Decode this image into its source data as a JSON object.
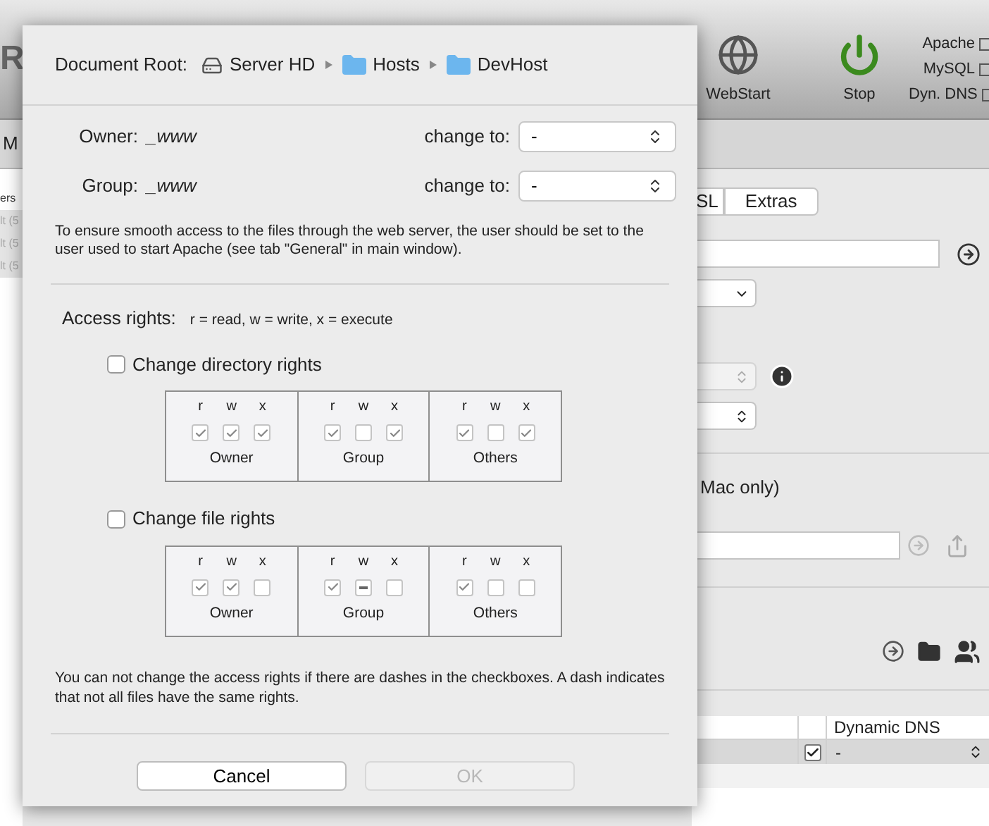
{
  "toolbar": {
    "logo": "R",
    "buttons": [
      {
        "label": "WebStart",
        "kind": "globe"
      },
      {
        "label": "Stop",
        "kind": "power"
      }
    ],
    "status": [
      {
        "label": "Apache"
      },
      {
        "label": "MySQL"
      },
      {
        "label": "Dyn. DNS"
      }
    ]
  },
  "tab_bar": {
    "tabs": [
      "M"
    ]
  },
  "sidebar": {
    "items": [
      {
        "label": "ers",
        "selected": false
      },
      {
        "label": "lt (5",
        "selected": true
      },
      {
        "label": "lt (5",
        "selected": true
      },
      {
        "label": "lt (5",
        "selected": true
      }
    ]
  },
  "panel": {
    "tabs": [
      {
        "label": "SL",
        "selected": false
      },
      {
        "label": "Extras",
        "selected": false
      }
    ],
    "note": "Mac only)",
    "table": {
      "columns": [
        "Dynamic DNS"
      ],
      "rows": [
        {
          "checked": true,
          "value": "-",
          "selected": true
        }
      ]
    }
  },
  "dialog": {
    "document_root": {
      "label": "Document Root:",
      "path": [
        {
          "name": "Server HD",
          "kind": "disk"
        },
        {
          "name": "Hosts",
          "kind": "folder"
        },
        {
          "name": "DevHost",
          "kind": "folder"
        }
      ]
    },
    "owners": [
      {
        "label": "Owner:",
        "value": "_www",
        "change_label": "change to:",
        "select": "-"
      },
      {
        "label": "Group:",
        "value": "_www",
        "change_label": "change to:",
        "select": "-"
      }
    ],
    "hint": "To ensure smooth access to the files through the web server, the user should be set to the user used to start Apache (see tab \"General\" in main window).",
    "access": {
      "label": "Access rights:",
      "legend": "r = read, w = write, x = execute"
    },
    "sections": [
      {
        "label": "Change directory rights",
        "checked": false,
        "groups": [
          {
            "name": "Owner",
            "bits": [
              {
                "letter": "r",
                "checked": true,
                "mixed": false
              },
              {
                "letter": "w",
                "checked": true,
                "mixed": false
              },
              {
                "letter": "x",
                "checked": true,
                "mixed": false
              }
            ]
          },
          {
            "name": "Group",
            "bits": [
              {
                "letter": "r",
                "checked": true,
                "mixed": false
              },
              {
                "letter": "w",
                "checked": false,
                "mixed": false
              },
              {
                "letter": "x",
                "checked": true,
                "mixed": false
              }
            ]
          },
          {
            "name": "Others",
            "bits": [
              {
                "letter": "r",
                "checked": true,
                "mixed": false
              },
              {
                "letter": "w",
                "checked": false,
                "mixed": false
              },
              {
                "letter": "x",
                "checked": true,
                "mixed": false
              }
            ]
          }
        ]
      },
      {
        "label": "Change file rights",
        "checked": false,
        "groups": [
          {
            "name": "Owner",
            "bits": [
              {
                "letter": "r",
                "checked": true,
                "mixed": false
              },
              {
                "letter": "w",
                "checked": true,
                "mixed": false
              },
              {
                "letter": "x",
                "checked": false,
                "mixed": false
              }
            ]
          },
          {
            "name": "Group",
            "bits": [
              {
                "letter": "r",
                "checked": true,
                "mixed": false
              },
              {
                "letter": "w",
                "checked": false,
                "mixed": true
              },
              {
                "letter": "x",
                "checked": false,
                "mixed": false
              }
            ]
          },
          {
            "name": "Others",
            "bits": [
              {
                "letter": "r",
                "checked": true,
                "mixed": false
              },
              {
                "letter": "w",
                "checked": false,
                "mixed": false
              },
              {
                "letter": "x",
                "checked": false,
                "mixed": false
              }
            ]
          }
        ]
      }
    ],
    "warning": "You can not change the access rights if there are dashes in the checkboxes. A dash indicates that not all files have the same rights.",
    "buttons": [
      {
        "label": "Cancel",
        "disabled": false
      },
      {
        "label": "OK",
        "disabled": true
      }
    ]
  }
}
